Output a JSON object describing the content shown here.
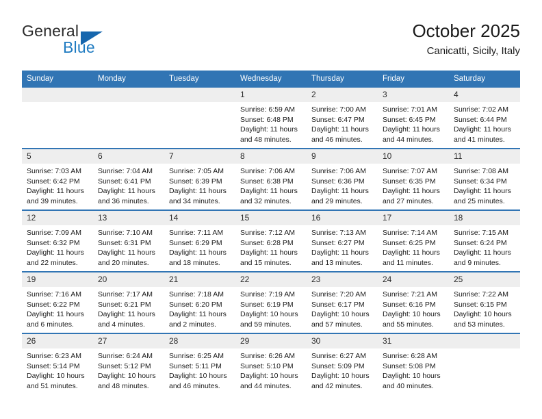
{
  "brand": {
    "name_top": "General",
    "name_bottom": "Blue",
    "color_primary": "#1f7bc1",
    "color_triangle": "#1666ad",
    "color_text": "#2b2b2b"
  },
  "header": {
    "title": "October 2025",
    "subtitle": "Canicatti, Sicily, Italy"
  },
  "theme": {
    "header_bg": "#3175b4",
    "header_text": "#ffffff",
    "daynum_bg": "#eeeeee",
    "row_divider": "#3175b4"
  },
  "weekdays": [
    "Sunday",
    "Monday",
    "Tuesday",
    "Wednesday",
    "Thursday",
    "Friday",
    "Saturday"
  ],
  "labels": {
    "sunrise_prefix": "Sunrise:",
    "sunset_prefix": "Sunset:",
    "daylight_prefix": "Daylight:"
  },
  "weeks": [
    [
      {
        "day": "",
        "empty": true
      },
      {
        "day": "",
        "empty": true
      },
      {
        "day": "",
        "empty": true
      },
      {
        "day": "1",
        "sunrise": "Sunrise: 6:59 AM",
        "sunset": "Sunset: 6:48 PM",
        "daylight": "Daylight: 11 hours and 48 minutes."
      },
      {
        "day": "2",
        "sunrise": "Sunrise: 7:00 AM",
        "sunset": "Sunset: 6:47 PM",
        "daylight": "Daylight: 11 hours and 46 minutes."
      },
      {
        "day": "3",
        "sunrise": "Sunrise: 7:01 AM",
        "sunset": "Sunset: 6:45 PM",
        "daylight": "Daylight: 11 hours and 44 minutes."
      },
      {
        "day": "4",
        "sunrise": "Sunrise: 7:02 AM",
        "sunset": "Sunset: 6:44 PM",
        "daylight": "Daylight: 11 hours and 41 minutes."
      }
    ],
    [
      {
        "day": "5",
        "sunrise": "Sunrise: 7:03 AM",
        "sunset": "Sunset: 6:42 PM",
        "daylight": "Daylight: 11 hours and 39 minutes."
      },
      {
        "day": "6",
        "sunrise": "Sunrise: 7:04 AM",
        "sunset": "Sunset: 6:41 PM",
        "daylight": "Daylight: 11 hours and 36 minutes."
      },
      {
        "day": "7",
        "sunrise": "Sunrise: 7:05 AM",
        "sunset": "Sunset: 6:39 PM",
        "daylight": "Daylight: 11 hours and 34 minutes."
      },
      {
        "day": "8",
        "sunrise": "Sunrise: 7:06 AM",
        "sunset": "Sunset: 6:38 PM",
        "daylight": "Daylight: 11 hours and 32 minutes."
      },
      {
        "day": "9",
        "sunrise": "Sunrise: 7:06 AM",
        "sunset": "Sunset: 6:36 PM",
        "daylight": "Daylight: 11 hours and 29 minutes."
      },
      {
        "day": "10",
        "sunrise": "Sunrise: 7:07 AM",
        "sunset": "Sunset: 6:35 PM",
        "daylight": "Daylight: 11 hours and 27 minutes."
      },
      {
        "day": "11",
        "sunrise": "Sunrise: 7:08 AM",
        "sunset": "Sunset: 6:34 PM",
        "daylight": "Daylight: 11 hours and 25 minutes."
      }
    ],
    [
      {
        "day": "12",
        "sunrise": "Sunrise: 7:09 AM",
        "sunset": "Sunset: 6:32 PM",
        "daylight": "Daylight: 11 hours and 22 minutes."
      },
      {
        "day": "13",
        "sunrise": "Sunrise: 7:10 AM",
        "sunset": "Sunset: 6:31 PM",
        "daylight": "Daylight: 11 hours and 20 minutes."
      },
      {
        "day": "14",
        "sunrise": "Sunrise: 7:11 AM",
        "sunset": "Sunset: 6:29 PM",
        "daylight": "Daylight: 11 hours and 18 minutes."
      },
      {
        "day": "15",
        "sunrise": "Sunrise: 7:12 AM",
        "sunset": "Sunset: 6:28 PM",
        "daylight": "Daylight: 11 hours and 15 minutes."
      },
      {
        "day": "16",
        "sunrise": "Sunrise: 7:13 AM",
        "sunset": "Sunset: 6:27 PM",
        "daylight": "Daylight: 11 hours and 13 minutes."
      },
      {
        "day": "17",
        "sunrise": "Sunrise: 7:14 AM",
        "sunset": "Sunset: 6:25 PM",
        "daylight": "Daylight: 11 hours and 11 minutes."
      },
      {
        "day": "18",
        "sunrise": "Sunrise: 7:15 AM",
        "sunset": "Sunset: 6:24 PM",
        "daylight": "Daylight: 11 hours and 9 minutes."
      }
    ],
    [
      {
        "day": "19",
        "sunrise": "Sunrise: 7:16 AM",
        "sunset": "Sunset: 6:22 PM",
        "daylight": "Daylight: 11 hours and 6 minutes."
      },
      {
        "day": "20",
        "sunrise": "Sunrise: 7:17 AM",
        "sunset": "Sunset: 6:21 PM",
        "daylight": "Daylight: 11 hours and 4 minutes."
      },
      {
        "day": "21",
        "sunrise": "Sunrise: 7:18 AM",
        "sunset": "Sunset: 6:20 PM",
        "daylight": "Daylight: 11 hours and 2 minutes."
      },
      {
        "day": "22",
        "sunrise": "Sunrise: 7:19 AM",
        "sunset": "Sunset: 6:19 PM",
        "daylight": "Daylight: 10 hours and 59 minutes."
      },
      {
        "day": "23",
        "sunrise": "Sunrise: 7:20 AM",
        "sunset": "Sunset: 6:17 PM",
        "daylight": "Daylight: 10 hours and 57 minutes."
      },
      {
        "day": "24",
        "sunrise": "Sunrise: 7:21 AM",
        "sunset": "Sunset: 6:16 PM",
        "daylight": "Daylight: 10 hours and 55 minutes."
      },
      {
        "day": "25",
        "sunrise": "Sunrise: 7:22 AM",
        "sunset": "Sunset: 6:15 PM",
        "daylight": "Daylight: 10 hours and 53 minutes."
      }
    ],
    [
      {
        "day": "26",
        "sunrise": "Sunrise: 6:23 AM",
        "sunset": "Sunset: 5:14 PM",
        "daylight": "Daylight: 10 hours and 51 minutes."
      },
      {
        "day": "27",
        "sunrise": "Sunrise: 6:24 AM",
        "sunset": "Sunset: 5:12 PM",
        "daylight": "Daylight: 10 hours and 48 minutes."
      },
      {
        "day": "28",
        "sunrise": "Sunrise: 6:25 AM",
        "sunset": "Sunset: 5:11 PM",
        "daylight": "Daylight: 10 hours and 46 minutes."
      },
      {
        "day": "29",
        "sunrise": "Sunrise: 6:26 AM",
        "sunset": "Sunset: 5:10 PM",
        "daylight": "Daylight: 10 hours and 44 minutes."
      },
      {
        "day": "30",
        "sunrise": "Sunrise: 6:27 AM",
        "sunset": "Sunset: 5:09 PM",
        "daylight": "Daylight: 10 hours and 42 minutes."
      },
      {
        "day": "31",
        "sunrise": "Sunrise: 6:28 AM",
        "sunset": "Sunset: 5:08 PM",
        "daylight": "Daylight: 10 hours and 40 minutes."
      },
      {
        "day": "",
        "empty": true
      }
    ]
  ]
}
